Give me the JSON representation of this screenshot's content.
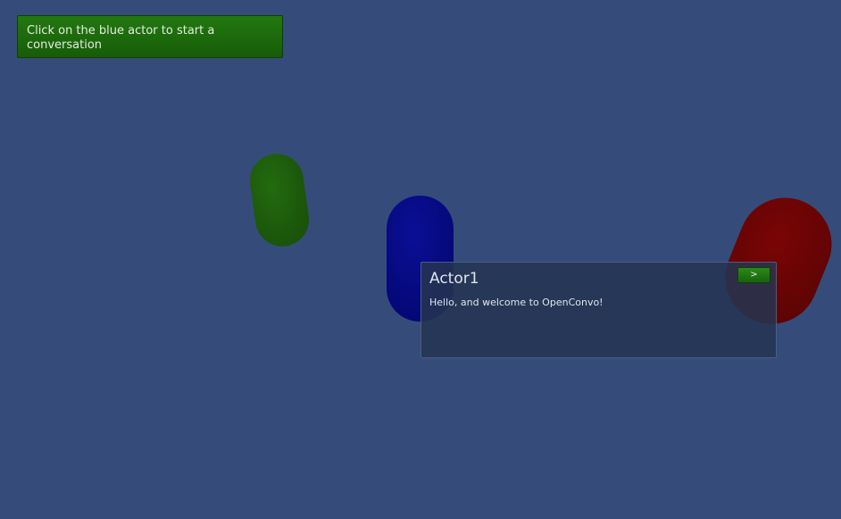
{
  "hint": {
    "text": "Click on the blue actor to start a conversation"
  },
  "actors": [
    {
      "name": "green-actor",
      "color": "#1c5c0c"
    },
    {
      "name": "blue-actor",
      "color": "#050885"
    },
    {
      "name": "red-actor",
      "color": "#6c0404"
    }
  ],
  "dialog": {
    "speaker": "Actor1",
    "message": "Hello, and welcome to OpenConvo!",
    "next_label": ">"
  }
}
